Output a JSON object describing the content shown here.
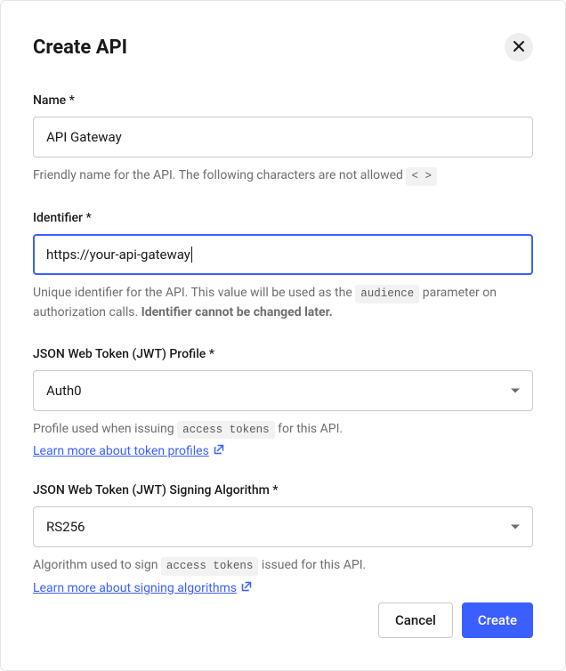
{
  "header": {
    "title": "Create API"
  },
  "fields": {
    "name": {
      "label": "Name *",
      "value": "API Gateway",
      "help_prefix": "Friendly name for the API. The following characters are not allowed ",
      "help_code": "< >"
    },
    "identifier": {
      "label": "Identifier *",
      "value": "https://your-api-gateway",
      "help_prefix": "Unique identifier for the API. This value will be used as the ",
      "help_code": "audience",
      "help_mid": " parameter on authorization calls. ",
      "help_strong": "Identifier cannot be changed later."
    },
    "jwt_profile": {
      "label": "JSON Web Token (JWT) Profile *",
      "value": "Auth0",
      "help_prefix": "Profile used when issuing ",
      "help_code": "access tokens",
      "help_suffix": " for this API.",
      "link": "Learn more about token profiles"
    },
    "jwt_algorithm": {
      "label": "JSON Web Token (JWT) Signing Algorithm *",
      "value": "RS256",
      "help_prefix": "Algorithm used to sign ",
      "help_code": "access tokens",
      "help_suffix": " issued for this API.",
      "link": "Learn more about signing algorithms"
    }
  },
  "footer": {
    "cancel": "Cancel",
    "create": "Create"
  }
}
